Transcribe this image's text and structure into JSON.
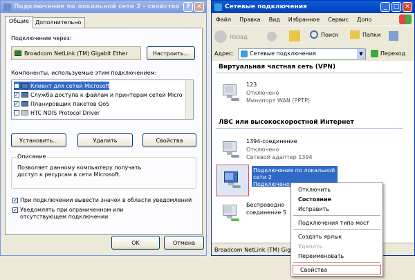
{
  "props_window": {
    "title": "Подключение по локальной сети 2 - свойства",
    "tabs": [
      {
        "label": "Общие"
      },
      {
        "label": "Дополнительно"
      }
    ],
    "connect_via_label": "Подключение через:",
    "adapter_name": "Broadcom NetLink (TM) Gigabit Ether",
    "configure_button": "Настроить...",
    "components_label": "Компоненты, используемые этим подключением:",
    "components": [
      {
        "label": "Клиент для сетей Microsoft",
        "checked": true,
        "selected": true
      },
      {
        "label": "Служба доступа к файлам и принтерам сетей Micro",
        "checked": true,
        "selected": false
      },
      {
        "label": "Планировщик пакетов QoS",
        "checked": true,
        "selected": false
      },
      {
        "label": "HTC NDIS Protocol Driver",
        "checked": false,
        "selected": false
      }
    ],
    "install_button": "Установить...",
    "remove_button": "Удалить",
    "properties_button": "Свойства",
    "description_title": "Описание",
    "description_text": "Позволяет данному компьютеру получать доступ к ресурсам в сети Microsoft.",
    "option1_label": "При подключении вывести значок в области уведомлений",
    "option2_label": "Уведомлять при ограниченном или отсутствующем подключении",
    "ok_button": "OK",
    "cancel_button": "Отмена"
  },
  "net_window": {
    "title": "Сетевые подключения",
    "menu": [
      "Файл",
      "Правка",
      "Вид",
      "Избранное",
      "Сервис",
      "Допо"
    ],
    "back_label": "Назад",
    "search_label": "Поиск",
    "folders_label": "Папки",
    "address_label": "Адрес:",
    "address_value": "Сетевые подключения",
    "go_label": "Переход",
    "group_vpn": "Виртуальная частная сеть (VPN)",
    "vpn_item": {
      "name": "123",
      "status": "Отключено",
      "device": "Минипорт WAN (PPTP)"
    },
    "group_lan": "ЛВС или высокоскоростной Интернет",
    "item_1394": {
      "name": "1394-соединение",
      "status": "Отключено",
      "device": "Сетевой адаптер 1394"
    },
    "item_lan2": {
      "name_line1": "Подключение по локальной",
      "name_line2": "сети 2",
      "status": "Подключено"
    },
    "item_wireless": {
      "name_line1": "Беспроводно",
      "name_line2": "соединение 5"
    },
    "status_bar": "Broadcom NetLink (TM) Giga"
  },
  "context_menu": {
    "items": [
      "Отключить",
      "Состояние",
      "Исправить",
      "Подключения типа мост",
      "Создать ярлык",
      "Удалить",
      "Переименовать",
      "Свойства"
    ]
  },
  "colors": {
    "highlight": "#316ac5",
    "red_outline": "#e05050",
    "title_active": "#0349c8"
  }
}
